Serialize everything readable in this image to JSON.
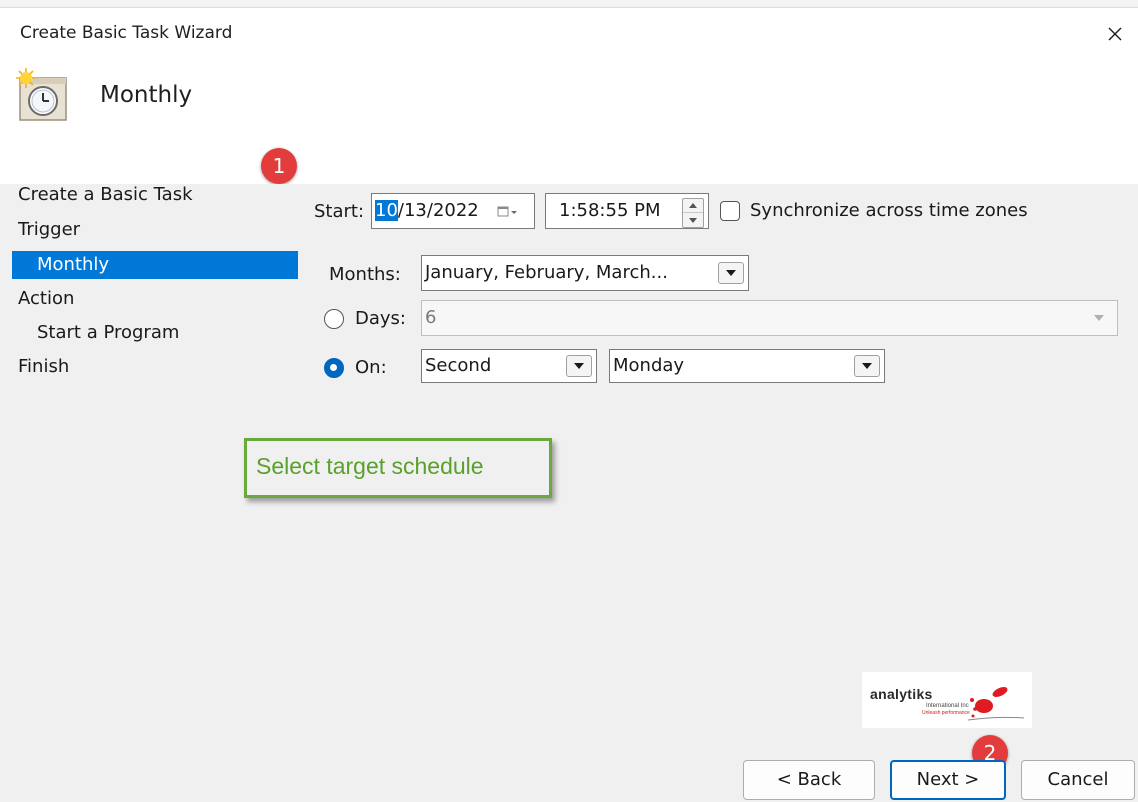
{
  "window": {
    "title": "Create Basic Task Wizard"
  },
  "header": {
    "title": "Monthly",
    "icon": "task-scheduler-clock-icon"
  },
  "nav": {
    "items": [
      {
        "label": "Create a Basic Task",
        "selected": false,
        "indent": 0
      },
      {
        "label": "Trigger",
        "selected": false,
        "indent": 0
      },
      {
        "label": "Monthly",
        "selected": true,
        "indent": 1
      },
      {
        "label": "Action",
        "selected": false,
        "indent": 0
      },
      {
        "label": "Start a Program",
        "selected": false,
        "indent": 1
      },
      {
        "label": "Finish",
        "selected": false,
        "indent": 0
      }
    ]
  },
  "badges": {
    "first": "1",
    "second": "2"
  },
  "form": {
    "start_label": "Start:",
    "start_date_highlight": "10",
    "start_date_rest": "/13/2022",
    "start_time": "1:58:55 PM",
    "sync_label": "Synchronize across time zones",
    "sync_checked": false,
    "months_label": "Months:",
    "months_value": "January, February, March...",
    "days_label": "Days:",
    "days_value": "6",
    "days_selected": false,
    "on_label": "On:",
    "on_selected": true,
    "on_week_value": "Second",
    "on_day_value": "Monday"
  },
  "callout": {
    "text": "Select target schedule"
  },
  "logo": {
    "name": "analytiks",
    "sub": "International Inc",
    "tagline": "Unleash performance"
  },
  "buttons": {
    "back": "< Back",
    "next": "Next >",
    "cancel": "Cancel"
  },
  "colors": {
    "selection": "#0078d7",
    "badge": "#e23c3c",
    "callout_border": "#6aaa3c",
    "callout_text": "#5aa02c"
  }
}
